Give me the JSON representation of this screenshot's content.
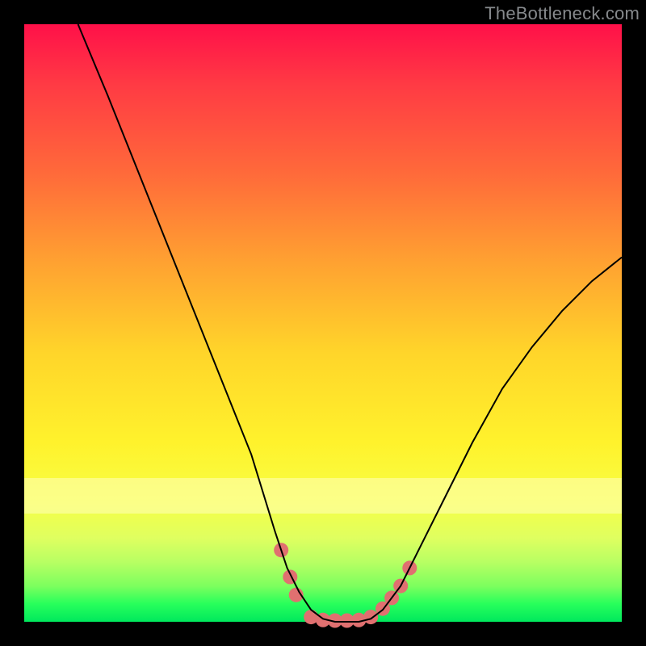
{
  "attribution": "TheBottleneck.com",
  "chart_data": {
    "type": "line",
    "title": "",
    "xlabel": "",
    "ylabel": "",
    "xlim": [
      0,
      100
    ],
    "ylim": [
      0,
      100
    ],
    "grid": false,
    "legend": false,
    "series": [
      {
        "name": "bottleneck-curve",
        "x": [
          9,
          14,
          18,
          22,
          26,
          30,
          34,
          38,
          42,
          44,
          46,
          48,
          50,
          52,
          54,
          56,
          58,
          60,
          63,
          66,
          70,
          75,
          80,
          85,
          90,
          95,
          100
        ],
        "y": [
          100,
          88,
          78,
          68,
          58,
          48,
          38,
          28,
          15,
          9,
          5,
          2,
          0.5,
          0,
          0,
          0,
          0.5,
          2,
          6,
          12,
          20,
          30,
          39,
          46,
          52,
          57,
          61
        ],
        "color": "#000000",
        "line_width": 2
      }
    ],
    "markers": {
      "name": "highlight-dots",
      "points": [
        {
          "x": 43.0,
          "y": 12.0
        },
        {
          "x": 44.5,
          "y": 7.5
        },
        {
          "x": 45.5,
          "y": 4.5
        },
        {
          "x": 48.0,
          "y": 0.8
        },
        {
          "x": 50.0,
          "y": 0.3
        },
        {
          "x": 52.0,
          "y": 0.2
        },
        {
          "x": 54.0,
          "y": 0.2
        },
        {
          "x": 56.0,
          "y": 0.3
        },
        {
          "x": 58.0,
          "y": 0.8
        },
        {
          "x": 60.0,
          "y": 2.2
        },
        {
          "x": 61.5,
          "y": 4.0
        },
        {
          "x": 63.0,
          "y": 6.0
        },
        {
          "x": 64.5,
          "y": 9.0
        }
      ],
      "color": "#e07070",
      "radius_px": 9
    },
    "pale_band_y": [
      19,
      25
    ]
  }
}
